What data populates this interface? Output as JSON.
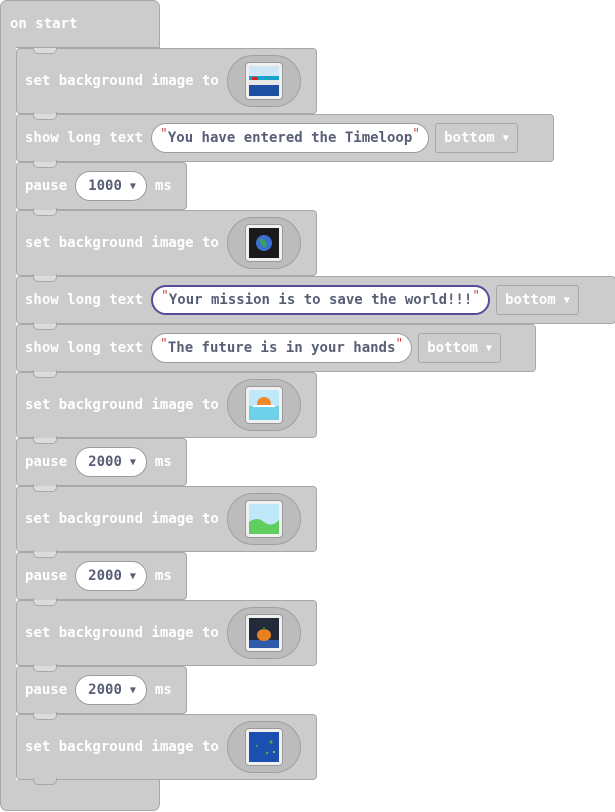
{
  "workspace": {
    "hat_label": "on start",
    "blocks": [
      {
        "kind": "bg",
        "label": "set background image to",
        "image_icon": "city-skyline-icon"
      },
      {
        "kind": "text",
        "label": "show long text",
        "text": "You have entered the Timeloop",
        "position": "bottom"
      },
      {
        "kind": "pause",
        "label": "pause",
        "value": "1000",
        "unit": "ms"
      },
      {
        "kind": "bg",
        "label": "set background image to",
        "image_icon": "planet-icon"
      },
      {
        "kind": "text",
        "label": "show long text",
        "text": "Your mission is to save the world!!!",
        "position": "bottom",
        "selected": true
      },
      {
        "kind": "text",
        "label": "show long text",
        "text": "The future is in your hands",
        "position": "bottom"
      },
      {
        "kind": "bg",
        "label": "set background image to",
        "image_icon": "sunset-icon"
      },
      {
        "kind": "pause",
        "label": "pause",
        "value": "2000",
        "unit": "ms"
      },
      {
        "kind": "bg",
        "label": "set background image to",
        "image_icon": "meadow-icon"
      },
      {
        "kind": "pause",
        "label": "pause",
        "value": "2000",
        "unit": "ms"
      },
      {
        "kind": "bg",
        "label": "set background image to",
        "image_icon": "pumpkin-night-icon"
      },
      {
        "kind": "pause",
        "label": "pause",
        "value": "2000",
        "unit": "ms"
      },
      {
        "kind": "bg",
        "label": "set background image to",
        "image_icon": "ocean-map-icon"
      }
    ]
  },
  "colors": {
    "block_fill": "#cccccc",
    "block_border": "#a8a8a8",
    "field_text": "#575e75",
    "quote": "#cc4444",
    "selection": "#5b4a9b"
  }
}
